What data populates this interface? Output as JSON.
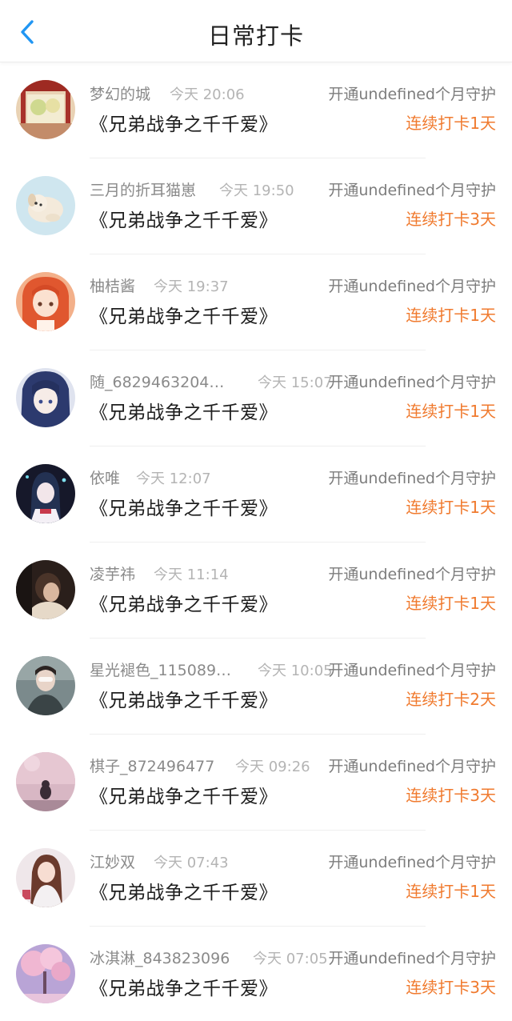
{
  "header": {
    "title": "日常打卡",
    "back_icon": "chevron-left-icon",
    "accent_color": "#2196f3"
  },
  "colors": {
    "streak": "#f07a2e",
    "name": "#8a8a8a",
    "time": "#b4b4b4"
  },
  "entries": [
    {
      "name": "梦幻的城",
      "time": "今天 20:06",
      "guard": "开通undefined个月守护",
      "book": "《兄弟战争之千千爱》",
      "streak": "连续打卡1天",
      "avatar": "house-garden-avatar"
    },
    {
      "name": "三月的折耳猫崽",
      "time": "今天 19:50",
      "guard": "开通undefined个月守护",
      "book": "《兄弟战争之千千爱》",
      "streak": "连续打卡3天",
      "avatar": "puppy-avatar"
    },
    {
      "name": "柚桔酱",
      "time": "今天 19:37",
      "guard": "开通undefined个月守护",
      "book": "《兄弟战争之千千爱》",
      "streak": "连续打卡1天",
      "avatar": "anime-girl-orange-avatar"
    },
    {
      "name": "随_6829463204…",
      "time": "今天 15:07",
      "guard": "开通undefined个月守护",
      "book": "《兄弟战争之千千爱》",
      "streak": "连续打卡1天",
      "avatar": "anime-girl-blue-avatar"
    },
    {
      "name": "依唯",
      "time": "今天 12:07",
      "guard": "开通undefined个月守护",
      "book": "《兄弟战争之千千爱》",
      "streak": "连续打卡1天",
      "avatar": "anime-girl-dark-avatar"
    },
    {
      "name": "凌芋祎",
      "time": "今天 11:14",
      "guard": "开通undefined个月守护",
      "book": "《兄弟战争之千千爱》",
      "streak": "连续打卡1天",
      "avatar": "photo-person-avatar"
    },
    {
      "name": "星光褪色_115089…",
      "time": "今天 10:05",
      "guard": "开通undefined个月守护",
      "book": "《兄弟战争之千千爱》",
      "streak": "连续打卡2天",
      "avatar": "photo-face-avatar"
    },
    {
      "name": "棋子_872496477",
      "time": "今天 09:26",
      "guard": "开通undefined个月守护",
      "book": "《兄弟战争之千千爱》",
      "streak": "连续打卡3天",
      "avatar": "pink-sky-avatar"
    },
    {
      "name": "江妙双",
      "time": "今天 07:43",
      "guard": "开通undefined个月守护",
      "book": "《兄弟战争之千千爱》",
      "streak": "连续打卡1天",
      "avatar": "photo-woman-avatar"
    },
    {
      "name": "冰淇淋_843823096",
      "time": "今天 07:05",
      "guard": "开通undefined个月守护",
      "book": "《兄弟战争之千千爱》",
      "streak": "连续打卡3天",
      "avatar": "cherry-tree-avatar"
    }
  ]
}
